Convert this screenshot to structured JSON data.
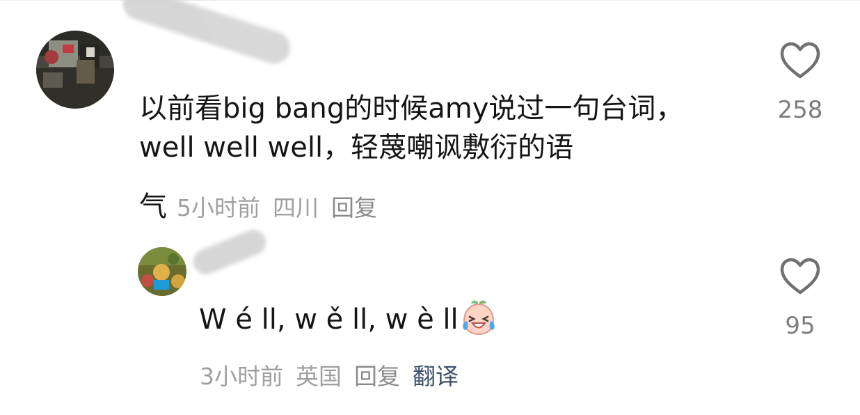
{
  "comments": [
    {
      "text": "以前看big bang的时候amy说过一句台词，well well well，轻蔑嘲讽敷衍的语",
      "text_tail": "气",
      "time": "5小时前",
      "location": "四川",
      "reply_label": "回复",
      "like_count": "258",
      "icons": {
        "like": "heart-icon",
        "avatar": "avatar"
      }
    },
    {
      "text": "W é ll, w ě ll, w è ll",
      "emoji": "laughing-tears-emoji",
      "time": "3小时前",
      "location": "英国",
      "reply_label": "回复",
      "translate_label": "翻译",
      "like_count": "95",
      "icons": {
        "like": "heart-icon",
        "avatar": "avatar"
      }
    }
  ],
  "colors": {
    "text": "#151515",
    "meta": "#a0a0a0",
    "translate": "#3d4f6d",
    "heart_stroke": "#707070"
  }
}
